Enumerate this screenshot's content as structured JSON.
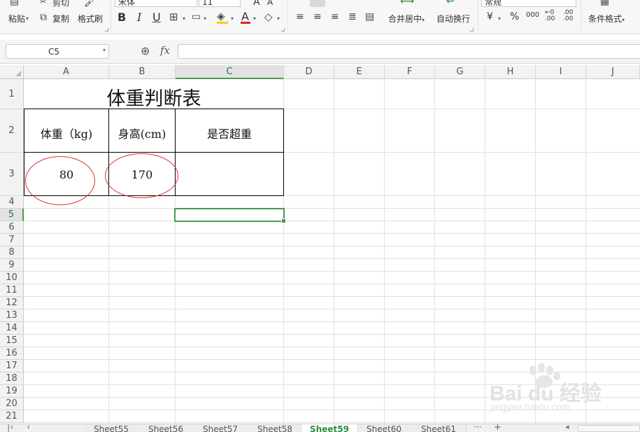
{
  "ribbon": {
    "cut": "剪切",
    "paste": "粘贴",
    "copy": "复制",
    "format_painter": "格式刷",
    "font_name": "宋体",
    "font_size": "11",
    "bold": "B",
    "italic": "I",
    "underline": "U",
    "font_color_glyph": "A",
    "increase_font": "A",
    "decrease_font": "A",
    "merge_center": "合并居中",
    "wrap_text": "自动换行",
    "number_format": "常规",
    "currency": "¥",
    "percent": "%",
    "thousands": "000",
    "increase_decimal": ".00",
    "decrease_decimal": ".00",
    "conditional_format": "条件格式"
  },
  "formula_bar": {
    "name_box": "C5",
    "zoom_glyph": "⊕",
    "fx": "fx",
    "value": ""
  },
  "columns": [
    "A",
    "B",
    "C",
    "D",
    "E",
    "F",
    "G",
    "H",
    "I",
    "J"
  ],
  "rows": [
    "1",
    "2",
    "3",
    "4",
    "5",
    "6",
    "7",
    "8",
    "9",
    "10",
    "11",
    "12",
    "13",
    "14",
    "15",
    "16",
    "17",
    "18",
    "19",
    "20",
    "21"
  ],
  "selected_cell": "C5",
  "table": {
    "title": "体重判断表",
    "header_weight": "体重（kg)",
    "header_height": "身高(cm)",
    "header_overweight": "是否超重",
    "weight_value": "80",
    "height_value": "170"
  },
  "sheets": {
    "items": [
      "Sheet55",
      "Sheet56",
      "Sheet57",
      "Sheet58",
      "Sheet59",
      "Sheet60",
      "Sheet61"
    ],
    "active": "Sheet59",
    "more": "···"
  },
  "watermark": {
    "brand": "Bai du 经验",
    "url": "jingyan.baidu.com"
  },
  "colors": {
    "accent_green": "#4a9a4a",
    "annotation_red": "#d8342f"
  }
}
